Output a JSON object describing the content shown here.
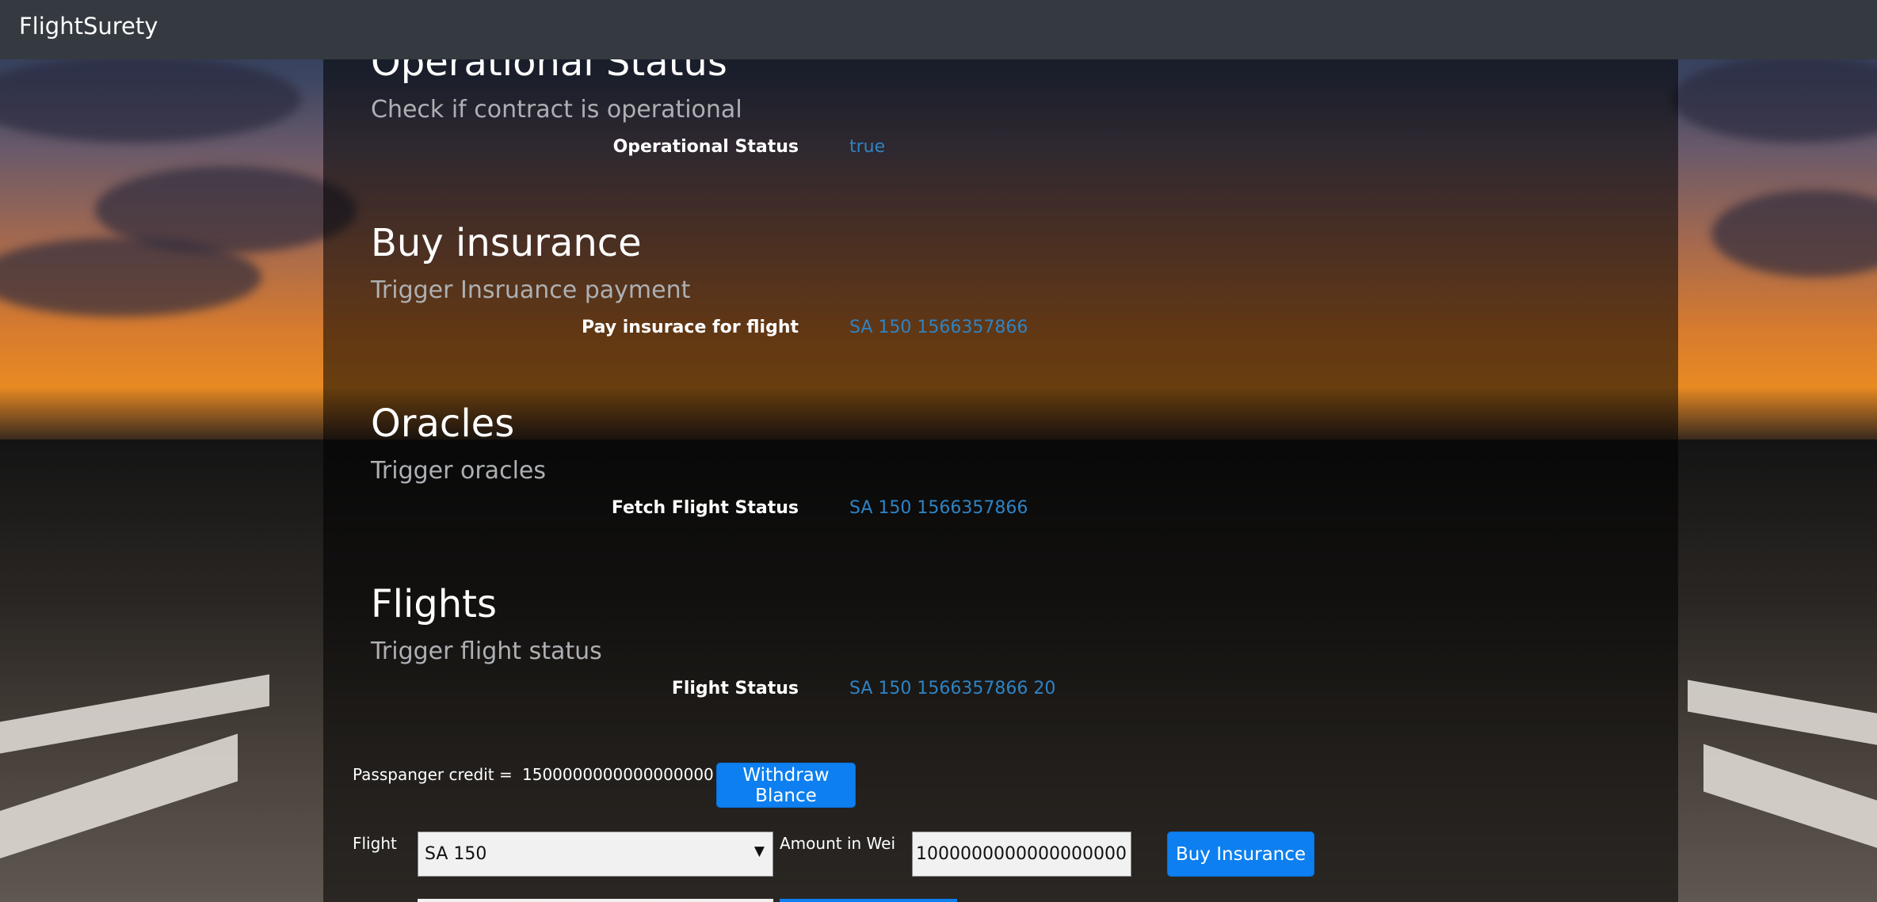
{
  "navbar": {
    "brand": "FlightSurety"
  },
  "sections": [
    {
      "title": "Operational Status",
      "subtitle": "Check if contract is operational",
      "label": "Operational Status",
      "value": "true"
    },
    {
      "title": "Buy insurance",
      "subtitle": "Trigger Insruance payment",
      "label": "Pay insurace for flight",
      "value": "SA 150 1566357866"
    },
    {
      "title": "Oracles",
      "subtitle": "Trigger oracles",
      "label": "Fetch Flight Status",
      "value": "SA 150 1566357866"
    },
    {
      "title": "Flights",
      "subtitle": "Trigger flight status",
      "label": "Flight Status",
      "value": "SA 150 1566357866 20"
    }
  ],
  "credit": {
    "label": "Passpanger credit =",
    "value": "1500000000000000000",
    "withdraw_label": "Withdraw Blance"
  },
  "purchase": {
    "flight_label": "Flight",
    "flight_selected": "SA 150",
    "amount_label": "Amount in Wei",
    "amount_value": "1000000000000000000",
    "buy_label": "Buy Insurance"
  },
  "colors": {
    "navbar": "#343a40",
    "accent": "#0d7ff0",
    "value_text": "#2e83c4",
    "subtitle": "#adb0b3"
  }
}
